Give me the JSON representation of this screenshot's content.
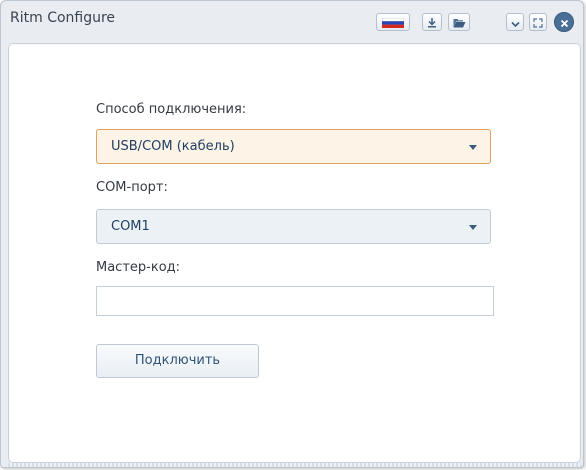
{
  "window": {
    "title": "Ritm Configure",
    "buttons": [
      {
        "name": "language-flag-button",
        "icon": "russian-flag-icon"
      },
      {
        "name": "download-button",
        "icon": "download-icon"
      },
      {
        "name": "open-folder-button",
        "icon": "folder-open-icon"
      },
      {
        "name": "collapse-button",
        "icon": "chevron-down-icon"
      },
      {
        "name": "fullscreen-button",
        "icon": "expand-icon"
      },
      {
        "name": "close-button",
        "icon": "close-icon"
      }
    ]
  },
  "form": {
    "connection_label": "Способ подключения:",
    "connection_value": "USB/COM (кабель)",
    "port_label": "COM-порт:",
    "port_value": "COM1",
    "master_code_label": "Мастер-код:",
    "master_code_value": "",
    "connect_button": "Подключить"
  },
  "colors": {
    "accent_border": "#e2a25c",
    "link_text": "#2f5376",
    "close_button": "#4a6f96"
  }
}
